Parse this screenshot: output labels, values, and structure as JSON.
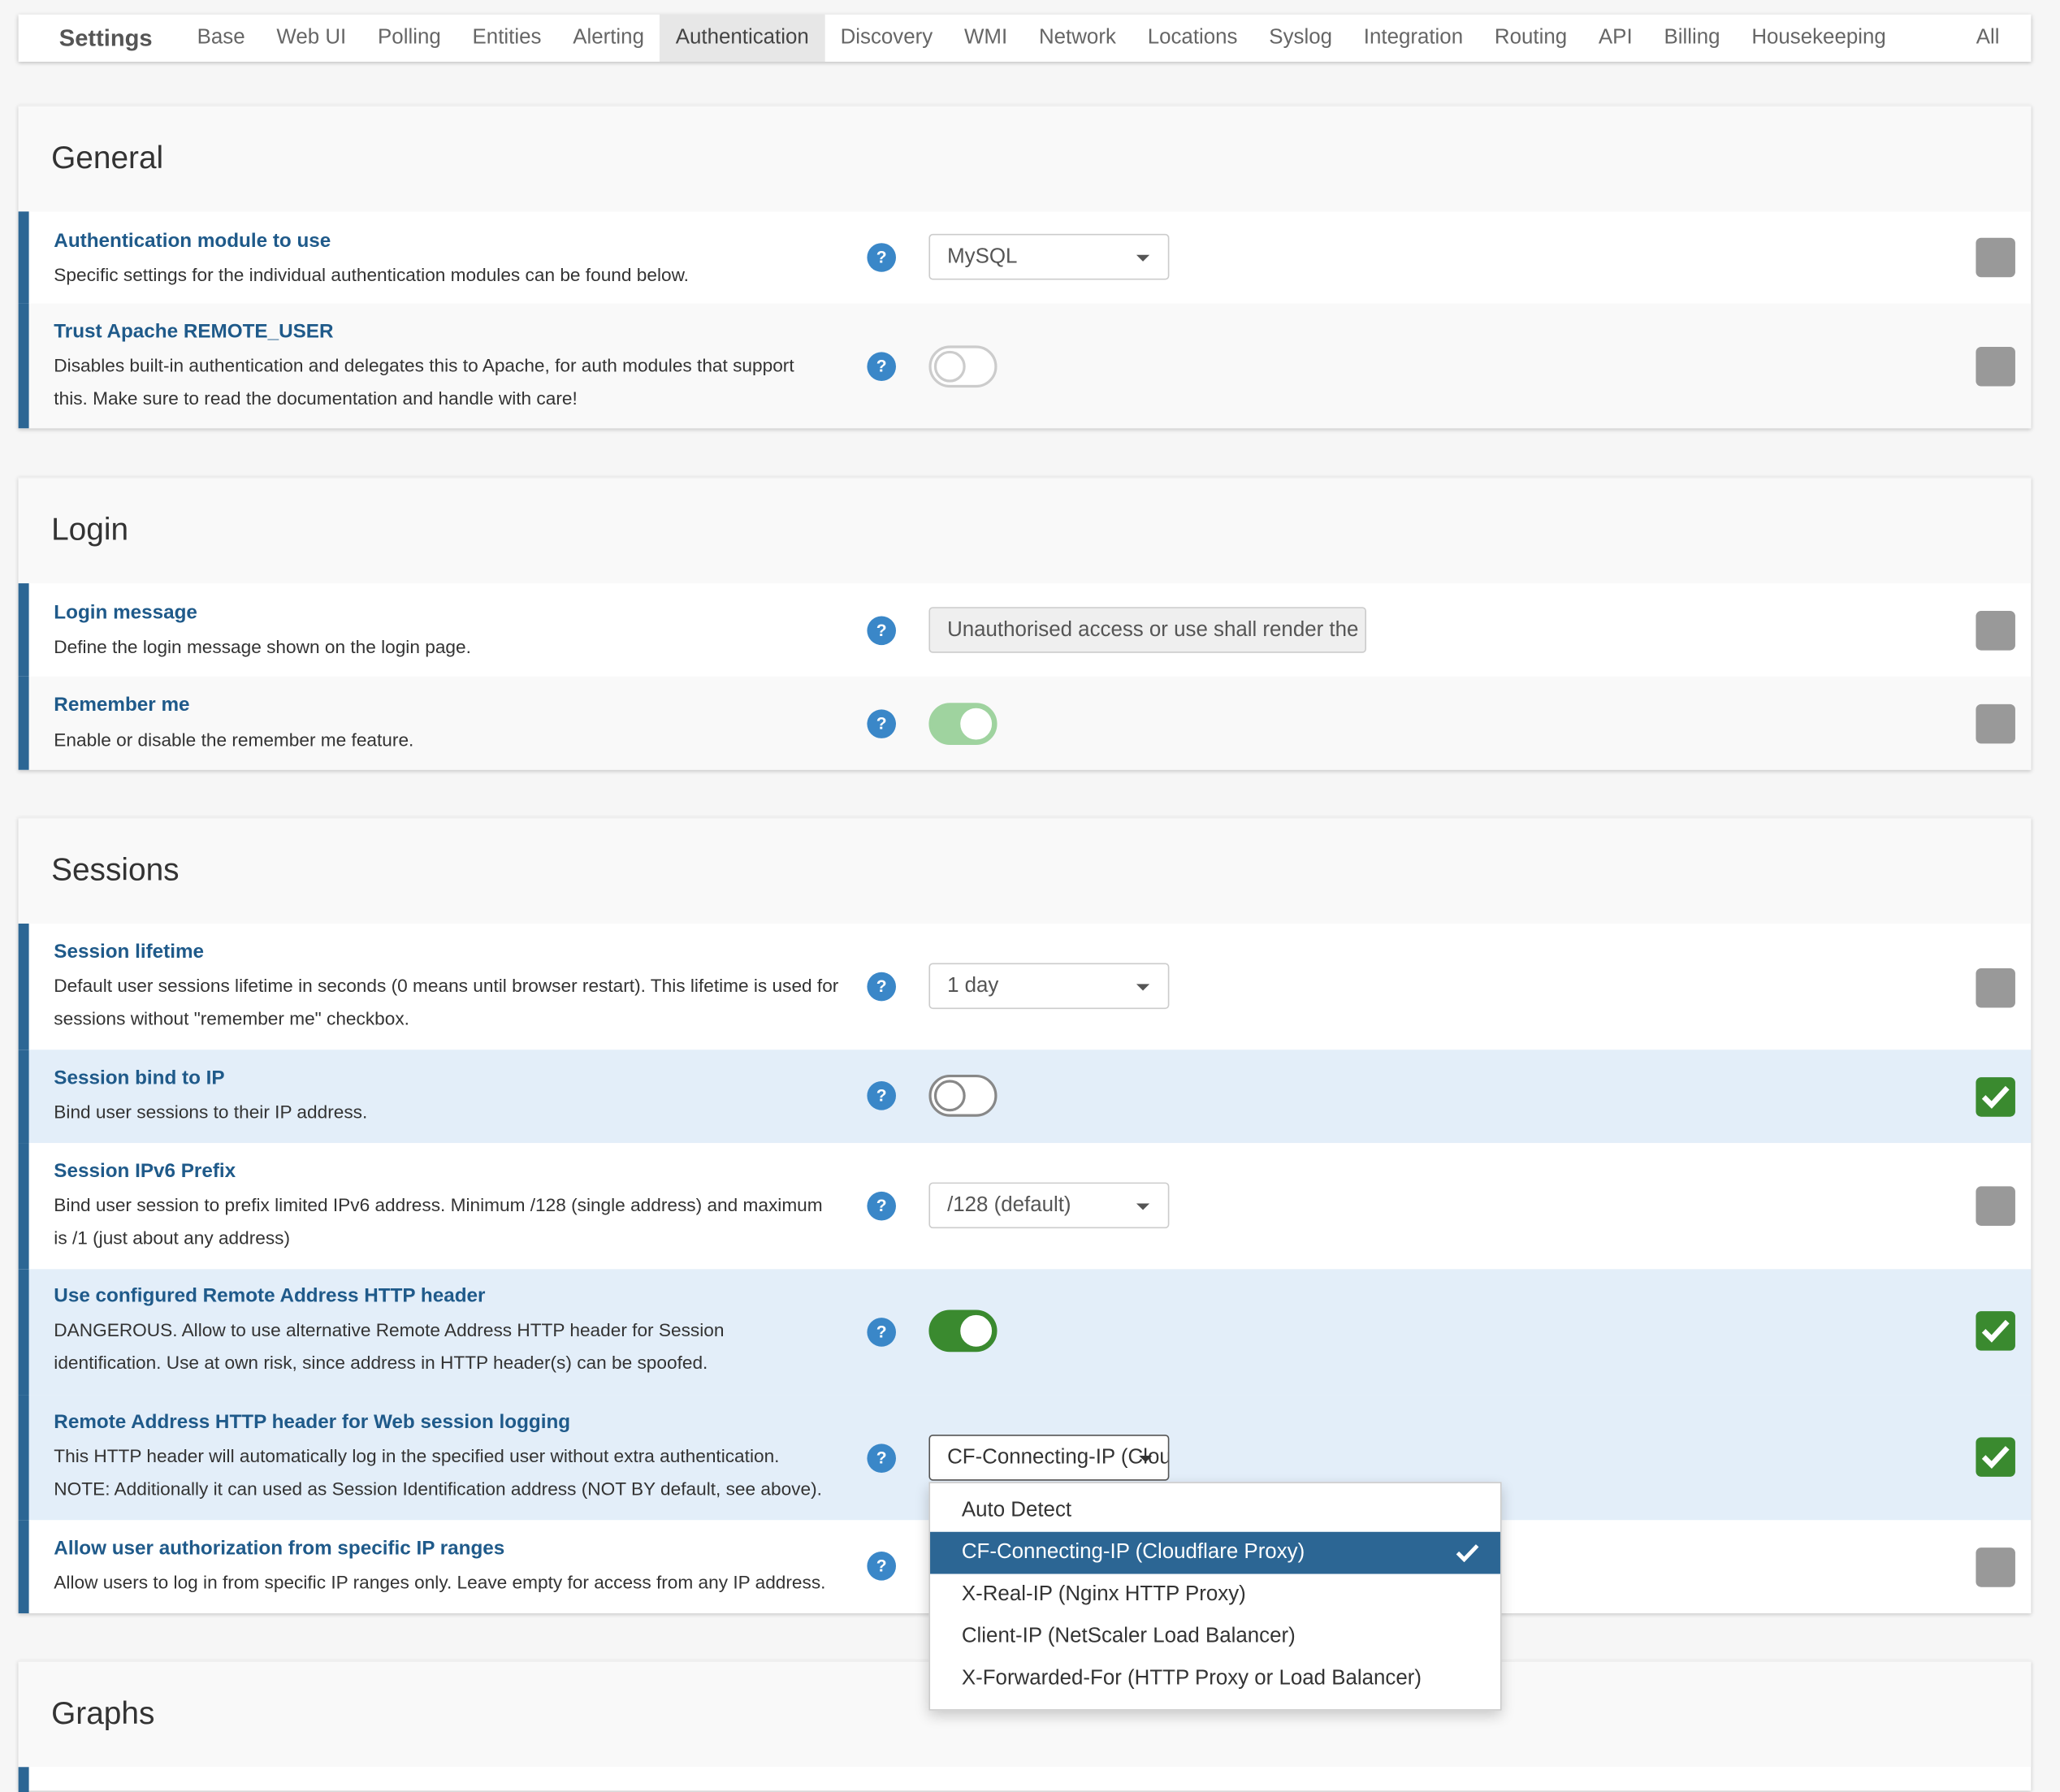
{
  "nav": {
    "brand": "Settings",
    "items": [
      "Base",
      "Web UI",
      "Polling",
      "Entities",
      "Alerting",
      "Authentication",
      "Discovery",
      "WMI",
      "Network",
      "Locations",
      "Syslog",
      "Integration",
      "Routing",
      "API",
      "Billing",
      "Housekeeping"
    ],
    "active": "Authentication",
    "all": "All"
  },
  "general": {
    "title": "General",
    "auth_module": {
      "title": "Authentication module to use",
      "desc": "Specific settings for the individual authentication modules can be found below.",
      "value": "MySQL"
    },
    "remote_user": {
      "title": "Trust Apache REMOTE_USER",
      "desc": "Disables built-in authentication and delegates this to Apache, for auth modules that support this. Make sure to read the documentation and handle with care!",
      "enabled": false
    }
  },
  "login": {
    "title": "Login",
    "message": {
      "title": "Login message",
      "desc": "Define the login message shown on the login page.",
      "value": "Unauthorised access or use shall render the user liable to criminal and/or civil prosecution."
    },
    "remember": {
      "title": "Remember me",
      "desc": "Enable or disable the remember me feature.",
      "enabled": true
    }
  },
  "sessions": {
    "title": "Sessions",
    "lifetime": {
      "title": "Session lifetime",
      "desc": "Default user sessions lifetime in seconds (0 means until browser restart). This lifetime is used for sessions without \"remember me\" checkbox.",
      "value": "1 day"
    },
    "bind_ip": {
      "title": "Session bind to IP",
      "desc": "Bind user sessions to their IP address.",
      "enabled": false
    },
    "ipv6": {
      "title": "Session IPv6 Prefix",
      "desc": "Bind user session to prefix limited IPv6 address. Minimum /128 (single address) and maximum is /1 (just about any address)",
      "value": "/128 (default)"
    },
    "remote_header": {
      "title": "Use configured Remote Address HTTP header",
      "desc": "DANGEROUS. Allow to use alternative Remote Address HTTP header for Session identification. Use at own risk, since address in HTTP header(s) can be spoofed.",
      "enabled": true
    },
    "header_logging": {
      "title": "Remote Address HTTP header for Web session logging",
      "desc": "This HTTP header will automatically log in the specified user without extra authentication. NOTE: Additionally it can used as Session Identification address (NOT BY default, see above).",
      "value": "CF-Connecting-IP (Cloudflare Proxy)",
      "options": [
        "Auto Detect",
        "CF-Connecting-IP (Cloudflare Proxy)",
        "X-Real-IP (Nginx HTTP Proxy)",
        "Client-IP (NetScaler Load Balancer)",
        "X-Forwarded-For (HTTP Proxy or Load Balancer)"
      ]
    },
    "ip_ranges": {
      "title": "Allow user authorization from specific IP ranges",
      "desc": "Allow users to log in from specific IP ranges only. Leave empty for access from any IP address."
    }
  },
  "graphs": {
    "title": "Graphs"
  },
  "help_glyph": "?"
}
